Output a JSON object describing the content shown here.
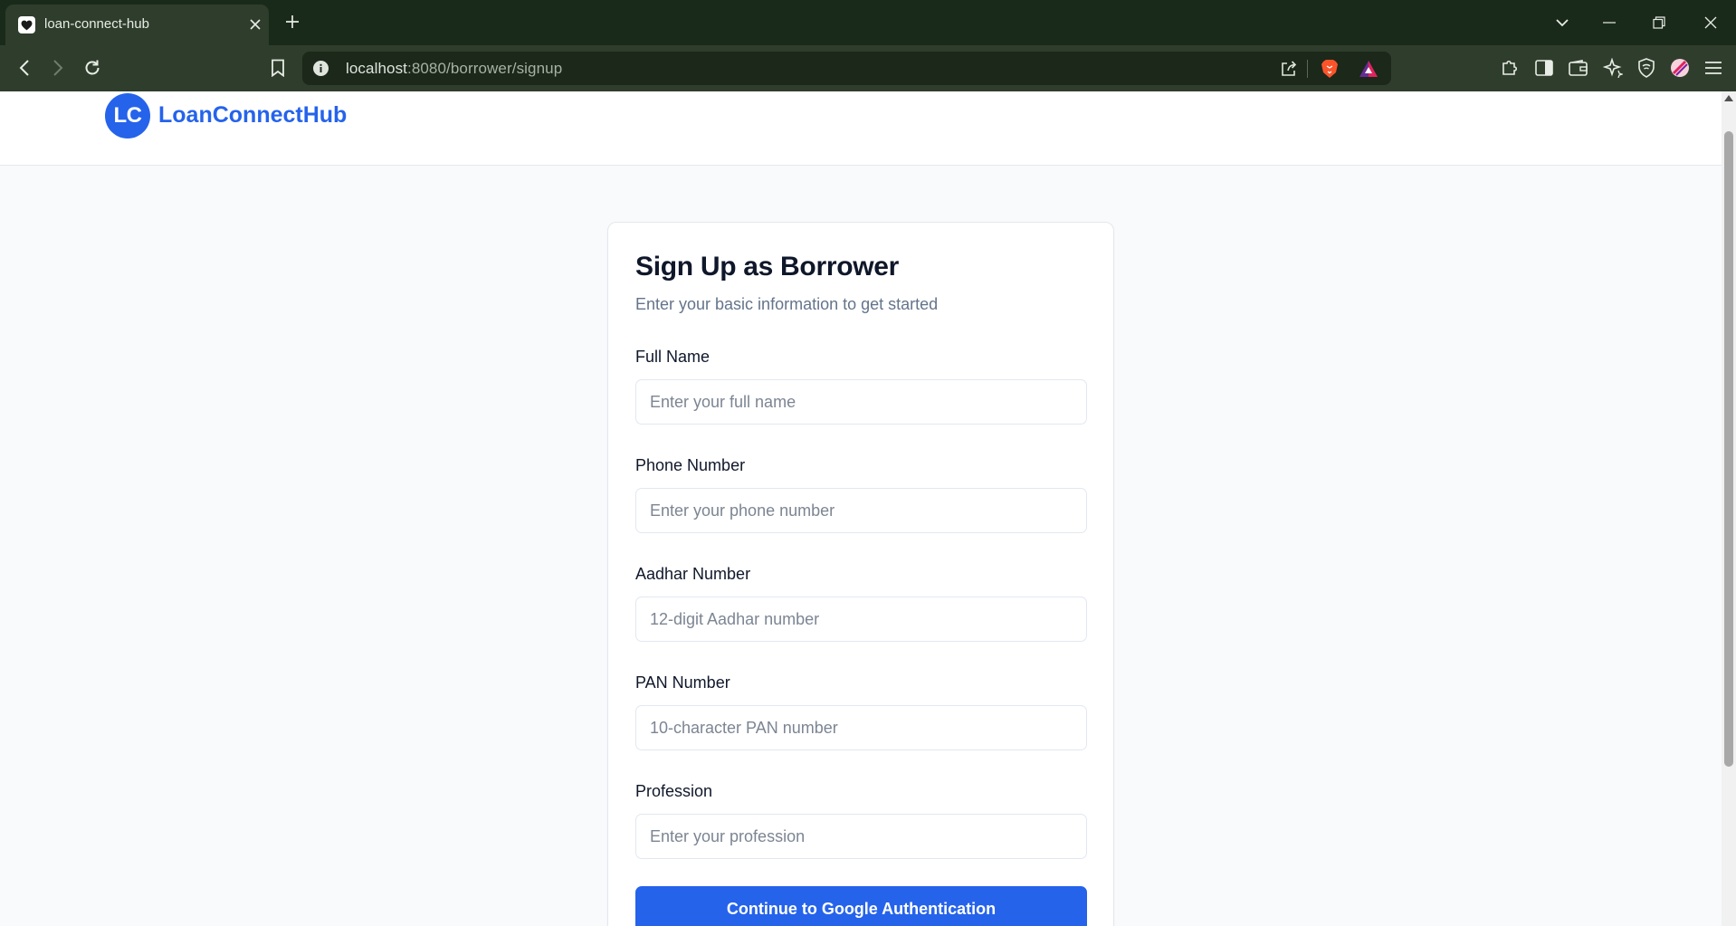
{
  "browser": {
    "tab_title": "loan-connect-hub",
    "url_host": "localhost",
    "url_rest": ":8080/borrower/signup",
    "icons": {
      "favicon": "heart-icon",
      "close_tab": "close-icon",
      "new_tab": "plus-icon",
      "tab_list": "chevron-down-icon",
      "minimize": "minimize-icon",
      "restore": "restore-icon",
      "close_window": "close-icon",
      "back": "back-arrow-icon",
      "forward": "forward-arrow-icon",
      "reload": "reload-icon",
      "bookmark": "bookmark-icon",
      "site_info": "info-icon",
      "share": "share-icon",
      "brave_shields": "brave-lion-icon",
      "brave_rewards": "brave-rewards-icon",
      "extensions": "puzzle-icon",
      "sidebar": "sidebar-icon",
      "wallet": "wallet-icon",
      "leo_ai": "sparkle-icon",
      "vpn": "shield-icon",
      "profile": "profile-icon",
      "menu": "hamburger-menu-icon"
    }
  },
  "header": {
    "logo_initials": "LC",
    "brand_name": "LoanConnectHub"
  },
  "signup_form": {
    "title": "Sign Up as Borrower",
    "subtitle": "Enter your basic information to get started",
    "fields": [
      {
        "label": "Full Name",
        "placeholder": "Enter your full name",
        "value": ""
      },
      {
        "label": "Phone Number",
        "placeholder": "Enter your phone number",
        "value": ""
      },
      {
        "label": "Aadhar Number",
        "placeholder": "12-digit Aadhar number",
        "value": ""
      },
      {
        "label": "PAN Number",
        "placeholder": "10-character PAN number",
        "value": ""
      },
      {
        "label": "Profession",
        "placeholder": "Enter your profession",
        "value": ""
      }
    ],
    "submit_label": "Continue to Google Authentication"
  },
  "colors": {
    "brand_primary": "#2563eb",
    "browser_frame": "#1a2a1a",
    "browser_toolbar": "#2f3e2c",
    "page_background": "#f8fafc"
  }
}
